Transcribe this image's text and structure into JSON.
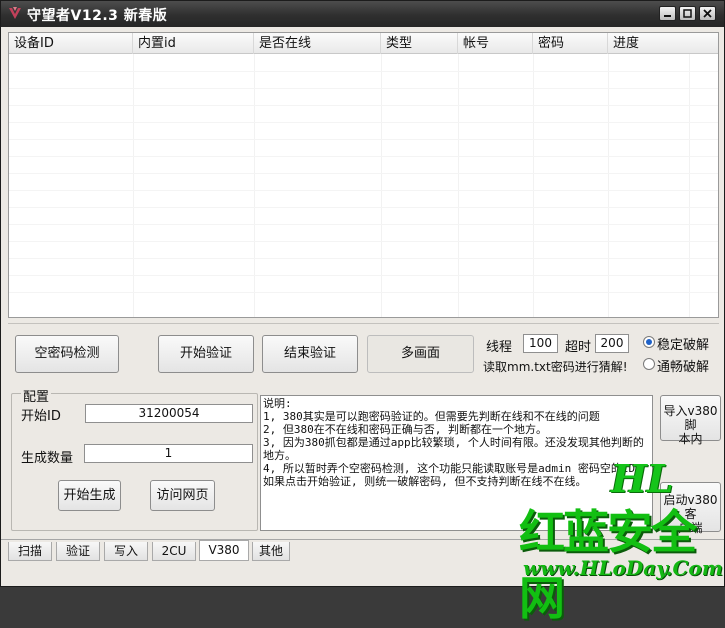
{
  "window": {
    "title": "守望者V12.3 新春版"
  },
  "table": {
    "columns": [
      "设备ID",
      "内置id",
      "是否在线",
      "类型",
      "帐号",
      "密码",
      "进度"
    ],
    "rows": []
  },
  "actions": {
    "empty_pwd_check": "空密码检测",
    "start_verify": "开始验证",
    "end_verify": "结束验证",
    "multi_screen": "多画面"
  },
  "settings": {
    "threads_label": "线程",
    "threads_value": "100",
    "timeout_label": "超时",
    "timeout_value": "200",
    "read_hint": "读取mm.txt密码进行猜解!",
    "mode_stable": "稳定破解",
    "mode_fast": "通畅破解",
    "mode_selected": "稳定破解"
  },
  "config": {
    "group_title": "配置",
    "start_id_label": "开始ID",
    "start_id_value": "31200054",
    "gen_count_label": "生成数量",
    "gen_count_value": "1",
    "start_generate": "开始生成",
    "visit_web": "访问网页"
  },
  "notes": [
    "说明:",
    "1, 380其实是可以跑密码验证的。但需要先判断在线和不在线的问题",
    "2, 但380在不在线和密码正确与否, 判断都在一个地方。",
    "3, 因为380抓包都是通过app比较繁琐, 个人时间有限。还没发现其他判断的地方。",
    "4, 所以暂时弄个空密码检测, 这个功能只能读取账号是admin 密码空的ID。如果点击开始验证, 则统一破解密码, 但不支持判断在线不在线。"
  ],
  "side_buttons": {
    "import_script_line1": "导入v380脚",
    "import_script_line2": "本内",
    "launch_client_line1": "启动v380客",
    "launch_client_line2": "户端"
  },
  "tabs": [
    "扫描",
    "验证",
    "写入",
    "2CU",
    "V380",
    "其他"
  ],
  "active_tab": "V380",
  "watermark": {
    "logo": "HL",
    "brand": "红蓝安全网",
    "url": "www.HLoDay.Com"
  },
  "colors": {
    "titlebar": "#2f2f2f",
    "window_bg": "#ece9e4",
    "watermark_green": "#12bf12",
    "radio_selected": "#1f62c8"
  }
}
